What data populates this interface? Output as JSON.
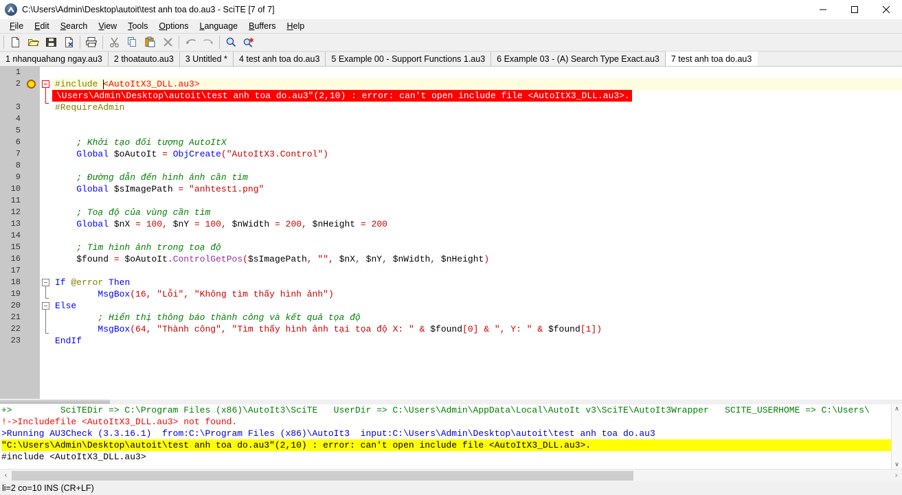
{
  "window": {
    "title": "C:\\Users\\Admin\\Desktop\\autoit\\test anh toa do.au3 - SciTE [7 of 7]",
    "icon": "scite-app-icon",
    "minimize_label": "—",
    "maximize_label": "□",
    "close_label": "✕"
  },
  "menubar": {
    "items": [
      {
        "label": "File",
        "mnemonic": "F"
      },
      {
        "label": "Edit",
        "mnemonic": "E"
      },
      {
        "label": "Search",
        "mnemonic": "S"
      },
      {
        "label": "View",
        "mnemonic": "V"
      },
      {
        "label": "Tools",
        "mnemonic": "T"
      },
      {
        "label": "Options",
        "mnemonic": "O"
      },
      {
        "label": "Language",
        "mnemonic": "L"
      },
      {
        "label": "Buffers",
        "mnemonic": "B"
      },
      {
        "label": "Help",
        "mnemonic": "H"
      }
    ]
  },
  "toolbar": {
    "buttons": [
      {
        "name": "new-file-icon",
        "tooltip": "New"
      },
      {
        "name": "open-file-icon",
        "tooltip": "Open"
      },
      {
        "name": "save-file-icon",
        "tooltip": "Save"
      },
      {
        "name": "close-file-icon",
        "tooltip": "Close"
      },
      {
        "name": "print-icon",
        "tooltip": "Print"
      },
      {
        "name": "cut-icon",
        "tooltip": "Cut"
      },
      {
        "name": "copy-icon",
        "tooltip": "Copy"
      },
      {
        "name": "paste-icon",
        "tooltip": "Paste"
      },
      {
        "name": "delete-icon",
        "tooltip": "Delete"
      },
      {
        "name": "undo-icon",
        "tooltip": "Undo"
      },
      {
        "name": "redo-icon",
        "tooltip": "Redo"
      },
      {
        "name": "find-icon",
        "tooltip": "Find"
      },
      {
        "name": "replace-icon",
        "tooltip": "Replace"
      }
    ]
  },
  "tabs": {
    "items": [
      {
        "label": "1 nhanquahang ngay.au3",
        "active": false
      },
      {
        "label": "2 thoatauto.au3",
        "active": false
      },
      {
        "label": "3 Untitled *",
        "active": false
      },
      {
        "label": "4 test anh toa do.au3",
        "active": false
      },
      {
        "label": "5 Example 00 - Support Functions 1.au3",
        "active": false
      },
      {
        "label": "6 Example 03 - (A) Search Type Exact.au3",
        "active": false
      },
      {
        "label": "7 test anh toa do.au3",
        "active": true
      }
    ]
  },
  "editor": {
    "current_line": 2,
    "bookmark_line": 2,
    "annotation": {
      "line_after": 2,
      "text": "\\Users\\Admin\\Desktop\\autoit\\test anh toa do.au3\"(2,10) : error: can't open include file <AutoItX3_DLL.au3>.",
      "bg": "#ff0000",
      "fg": "#ffffff"
    },
    "line_numbers": [
      "1",
      "2",
      "3",
      "4",
      "5",
      "6",
      "7",
      "8",
      "9",
      "10",
      "11",
      "12",
      "13",
      "14",
      "15",
      "16",
      "17",
      "18",
      "19",
      "20",
      "21",
      "22",
      "23"
    ],
    "lines": [
      {
        "n": 1,
        "text": ""
      },
      {
        "n": 2,
        "text": "#include <AutoItX3_DLL.au3>"
      },
      {
        "n": 3,
        "text": "#RequireAdmin"
      },
      {
        "n": 4,
        "text": ""
      },
      {
        "n": 5,
        "text": ""
      },
      {
        "n": 6,
        "text": "    ; Khởi tạo đối tượng AutoItX"
      },
      {
        "n": 7,
        "text": "    Global $oAutoIt = ObjCreate(\"AutoItX3.Control\")"
      },
      {
        "n": 8,
        "text": ""
      },
      {
        "n": 9,
        "text": "    ; Đường dẫn đến hình ảnh cần tìm"
      },
      {
        "n": 10,
        "text": "    Global $sImagePath = \"anhtest1.png\""
      },
      {
        "n": 11,
        "text": ""
      },
      {
        "n": 12,
        "text": "    ; Toạ độ của vùng cần tìm"
      },
      {
        "n": 13,
        "text": "    Global $nX = 100, $nY = 100, $nWidth = 200, $nHeight = 200"
      },
      {
        "n": 14,
        "text": ""
      },
      {
        "n": 15,
        "text": "    ; Tìm hình ảnh trong toạ độ"
      },
      {
        "n": 16,
        "text": "    $found = $oAutoIt.ControlGetPos($sImagePath, \"\", $nX, $nY, $nWidth, $nHeight)"
      },
      {
        "n": 17,
        "text": ""
      },
      {
        "n": 18,
        "text": "If @error Then"
      },
      {
        "n": 19,
        "text": "        MsgBox(16, \"Lỗi\", \"Không tìm thấy hình ảnh\")"
      },
      {
        "n": 20,
        "text": "Else"
      },
      {
        "n": 21,
        "text": "        ; Hiển thị thông báo thành công và kết quả tọa độ"
      },
      {
        "n": 22,
        "text": "        MsgBox(64, \"Thành công\", \"Tìm thấy hình ảnh tại tọa độ X: \" & $found[0] & \", Y: \" & $found[1])"
      },
      {
        "n": 23,
        "text": "EndIf"
      }
    ]
  },
  "output": {
    "lines": [
      {
        "id": "scite-dirs",
        "color": "#008000",
        "highlight": false,
        "text": "+>         SciTEDir => C:\\Program Files (x86)\\AutoIt3\\SciTE   UserDir => C:\\Users\\Admin\\AppData\\Local\\AutoIt v3\\SciTE\\AutoIt3Wrapper   SCITE_USERHOME => C:\\Users\\"
      },
      {
        "id": "includefile-not-found",
        "color": "#ff0000",
        "highlight": false,
        "text": "!->Includefile <AutoItX3_DLL.au3> not found."
      },
      {
        "id": "running-au3check",
        "color": "#0000cc",
        "highlight": false,
        "text": ">Running AU3Check (3.3.16.1)  from:C:\\Program Files (x86)\\AutoIt3  input:C:\\Users\\Admin\\Desktop\\autoit\\test anh toa do.au3"
      },
      {
        "id": "error-line",
        "color": "#000000",
        "highlight": true,
        "text": "\"C:\\Users\\Admin\\Desktop\\autoit\\test anh toa do.au3\"(2,10) : error: can't open include file <AutoItX3_DLL.au3>."
      },
      {
        "id": "include-echo",
        "color": "#000000",
        "highlight": false,
        "text": "#include <AutoItX3_DLL.au3>"
      }
    ],
    "scroll_up_label": "∧",
    "scroll_down_label": "∨"
  },
  "hscrollbar": {
    "left_arrow": "‹",
    "right_arrow": "›"
  },
  "statusbar": {
    "text": "li=2 co=10 INS (CR+LF)"
  },
  "colors": {
    "keyword": "#0000ff",
    "comment": "#008000",
    "string": "#cc0000",
    "number": "#cc0000",
    "preprocessor": "#808000",
    "macro": "#808000",
    "object_method": "#993399",
    "error_bg": "#ff0000",
    "highlight_bg": "#ffff00",
    "current_line_bg": "#fffde0",
    "margin_bg": "#c8c8c8"
  }
}
